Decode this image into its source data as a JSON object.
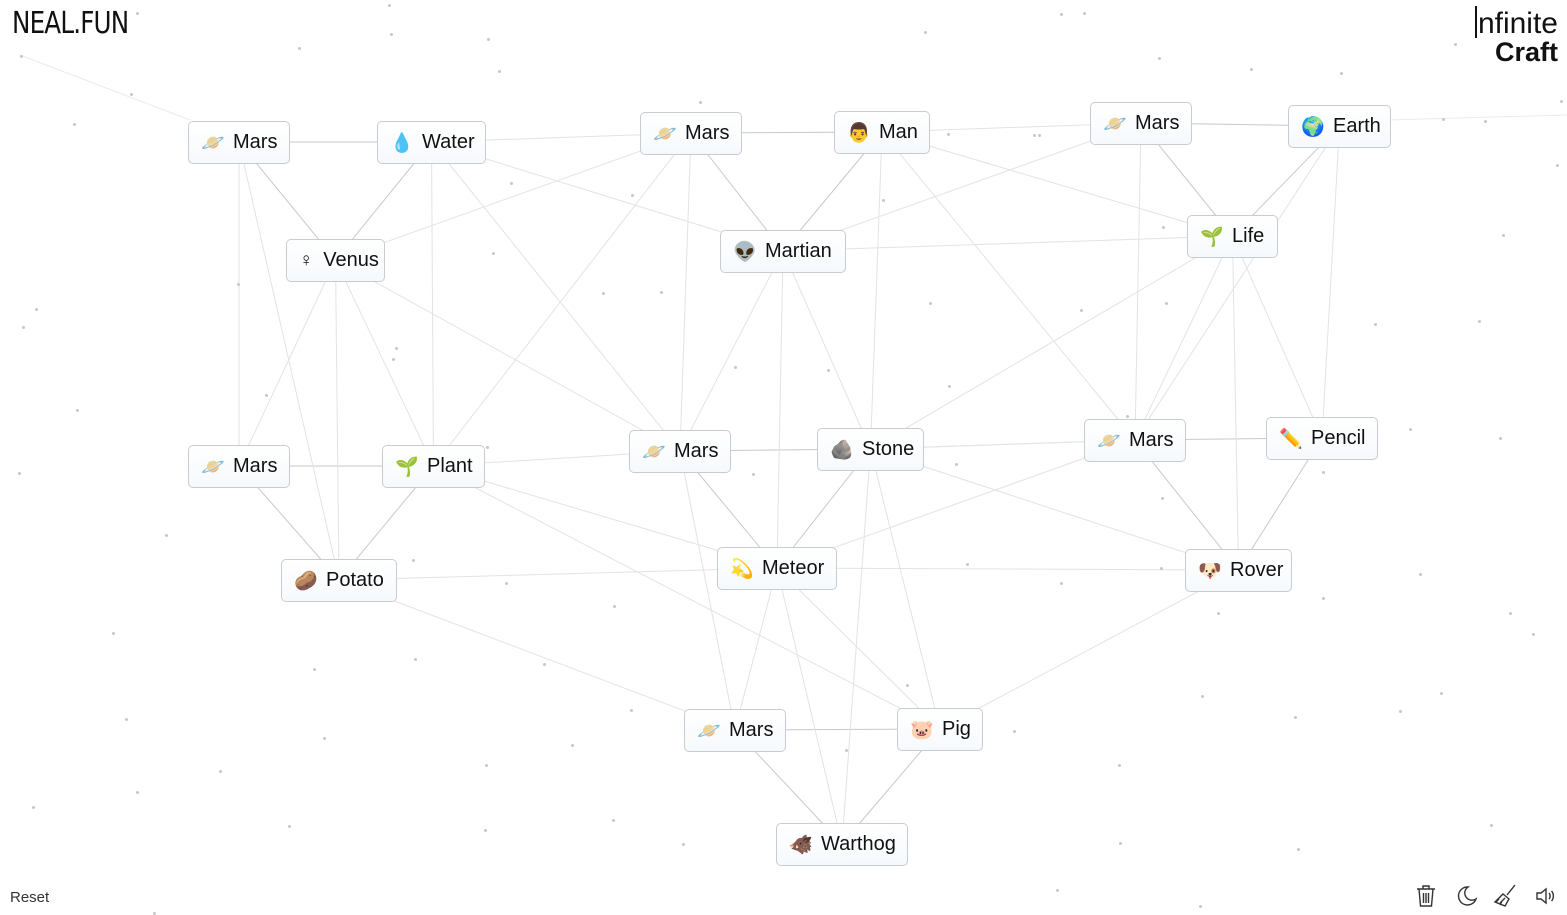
{
  "header": {
    "logo": "NEAL.FUN",
    "brand_line1": "nfinite",
    "brand_line2": "Craft"
  },
  "footer": {
    "reset_label": "Reset",
    "tools": [
      {
        "name": "trash-icon"
      },
      {
        "name": "moon-icon"
      },
      {
        "name": "broom-icon"
      },
      {
        "name": "sound-icon"
      }
    ]
  },
  "items": [
    {
      "id": "mars1",
      "emoji": "🪐",
      "label": "Mars"
    },
    {
      "id": "water",
      "emoji": "💧",
      "label": "Water"
    },
    {
      "id": "mars2",
      "emoji": "🪐",
      "label": "Mars"
    },
    {
      "id": "man",
      "emoji": "👨",
      "label": "Man"
    },
    {
      "id": "mars3",
      "emoji": "🪐",
      "label": "Mars"
    },
    {
      "id": "earth",
      "emoji": "🌍",
      "label": "Earth"
    },
    {
      "id": "venus",
      "emoji": "♀",
      "label": "Venus"
    },
    {
      "id": "martian",
      "emoji": "👽",
      "label": "Martian"
    },
    {
      "id": "life",
      "emoji": "🌱",
      "label": "Life"
    },
    {
      "id": "mars4",
      "emoji": "🪐",
      "label": "Mars"
    },
    {
      "id": "plant",
      "emoji": "🌱",
      "label": "Plant"
    },
    {
      "id": "mars5",
      "emoji": "🪐",
      "label": "Mars"
    },
    {
      "id": "stone",
      "emoji": "🪨",
      "label": "Stone"
    },
    {
      "id": "mars6",
      "emoji": "🪐",
      "label": "Mars"
    },
    {
      "id": "pencil",
      "emoji": "✏️",
      "label": "Pencil"
    },
    {
      "id": "potato",
      "emoji": "🥔",
      "label": "Potato"
    },
    {
      "id": "meteor",
      "emoji": "💫",
      "label": "Meteor"
    },
    {
      "id": "rover",
      "emoji": "🐶",
      "label": "Rover"
    },
    {
      "id": "mars7",
      "emoji": "🪐",
      "label": "Mars"
    },
    {
      "id": "pig",
      "emoji": "🐷",
      "label": "Pig"
    },
    {
      "id": "warthog",
      "emoji": "🐗",
      "label": "Warthog"
    }
  ]
}
